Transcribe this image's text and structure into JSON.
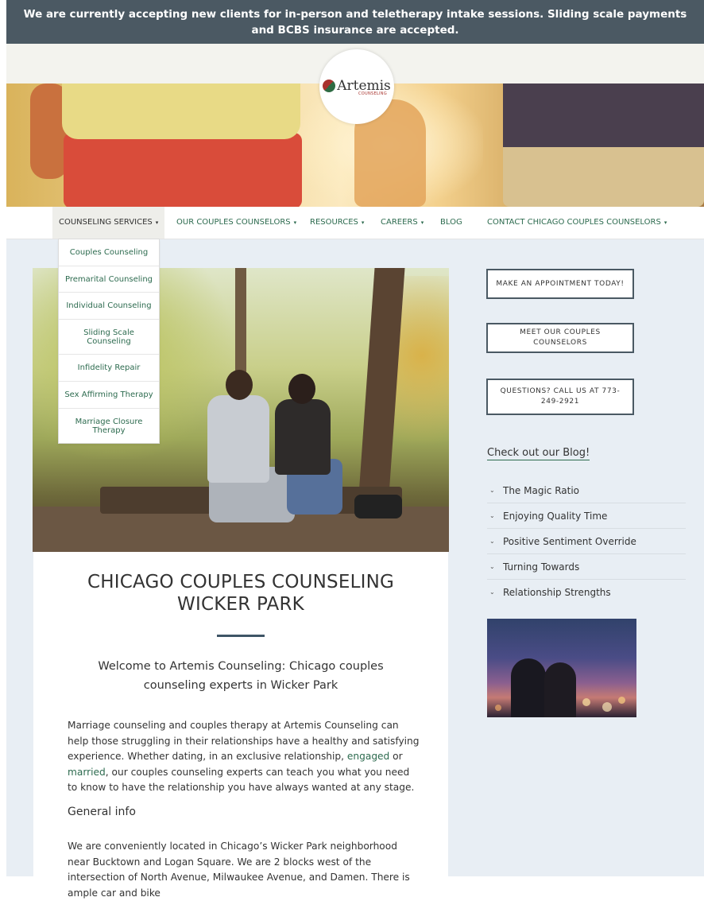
{
  "announcement": "We are currently accepting new clients for in-person and teletherapy intake sessions. Sliding scale payments and BCBS insurance are accepted.",
  "logo": {
    "name": "Artemis",
    "sub": "COUNSELING"
  },
  "nav": {
    "items": [
      {
        "label": "COUNSELING SERVICES",
        "caret": "▾"
      },
      {
        "label": "OUR COUPLES COUNSELORS",
        "caret": "▾"
      },
      {
        "label": "RESOURCES",
        "caret": "▾"
      },
      {
        "label": "CAREERS",
        "caret": "▾"
      },
      {
        "label": "BLOG",
        "caret": ""
      },
      {
        "label": "CONTACT CHICAGO COUPLES COUNSELORS",
        "caret": "▾"
      }
    ]
  },
  "dropdown": {
    "items": [
      "Couples Counseling",
      "Premarital Counseling",
      "Individual Counseling",
      "Sliding Scale Counseling",
      "Infidelity Repair",
      "Sex Affirming Therapy",
      "Marriage Closure Therapy"
    ]
  },
  "article": {
    "title_line1": "CHICAGO COUPLES COUNSELING",
    "title_line2": "WICKER PARK",
    "subtitle": "Welcome to Artemis Counseling: Chicago couples counseling experts in Wicker Park",
    "para1_a": "Marriage counseling and couples therapy at Artemis Counseling can help those struggling in their relationships have a healthy and satisfying experience. Whether dating, in an exclusive relationship, ",
    "link_engaged": "engaged",
    "para1_b": " or ",
    "link_married": "married",
    "para1_c": ", our couples counseling experts can teach you what you need to know to have the relationship you have always wanted at any stage.",
    "heading_general": "General info",
    "para2": "We are conveniently located in Chicago’s Wicker Park neighborhood near Bucktown and Logan Square. We are 2 blocks west of the intersection of North Avenue, Milwaukee Avenue, and Damen. There is ample car and bike"
  },
  "sidebar": {
    "btn_appointment": "MAKE AN APPOINTMENT TODAY!",
    "btn_counselors": "MEET OUR COUPLES COUNSELORS",
    "btn_call": "QUESTIONS? CALL US AT 773-249-2921",
    "blog_link": "Check out our Blog!",
    "blog_items": [
      "The Magic Ratio",
      "Enjoying Quality Time",
      "Positive Sentiment Override",
      "Turning Towards",
      "Relationship Strengths"
    ],
    "chevron": "⌄"
  },
  "colors": {
    "announce_bg": "#4b5963",
    "link_green": "#2d6b4f",
    "page_bg": "#e8eef4"
  }
}
